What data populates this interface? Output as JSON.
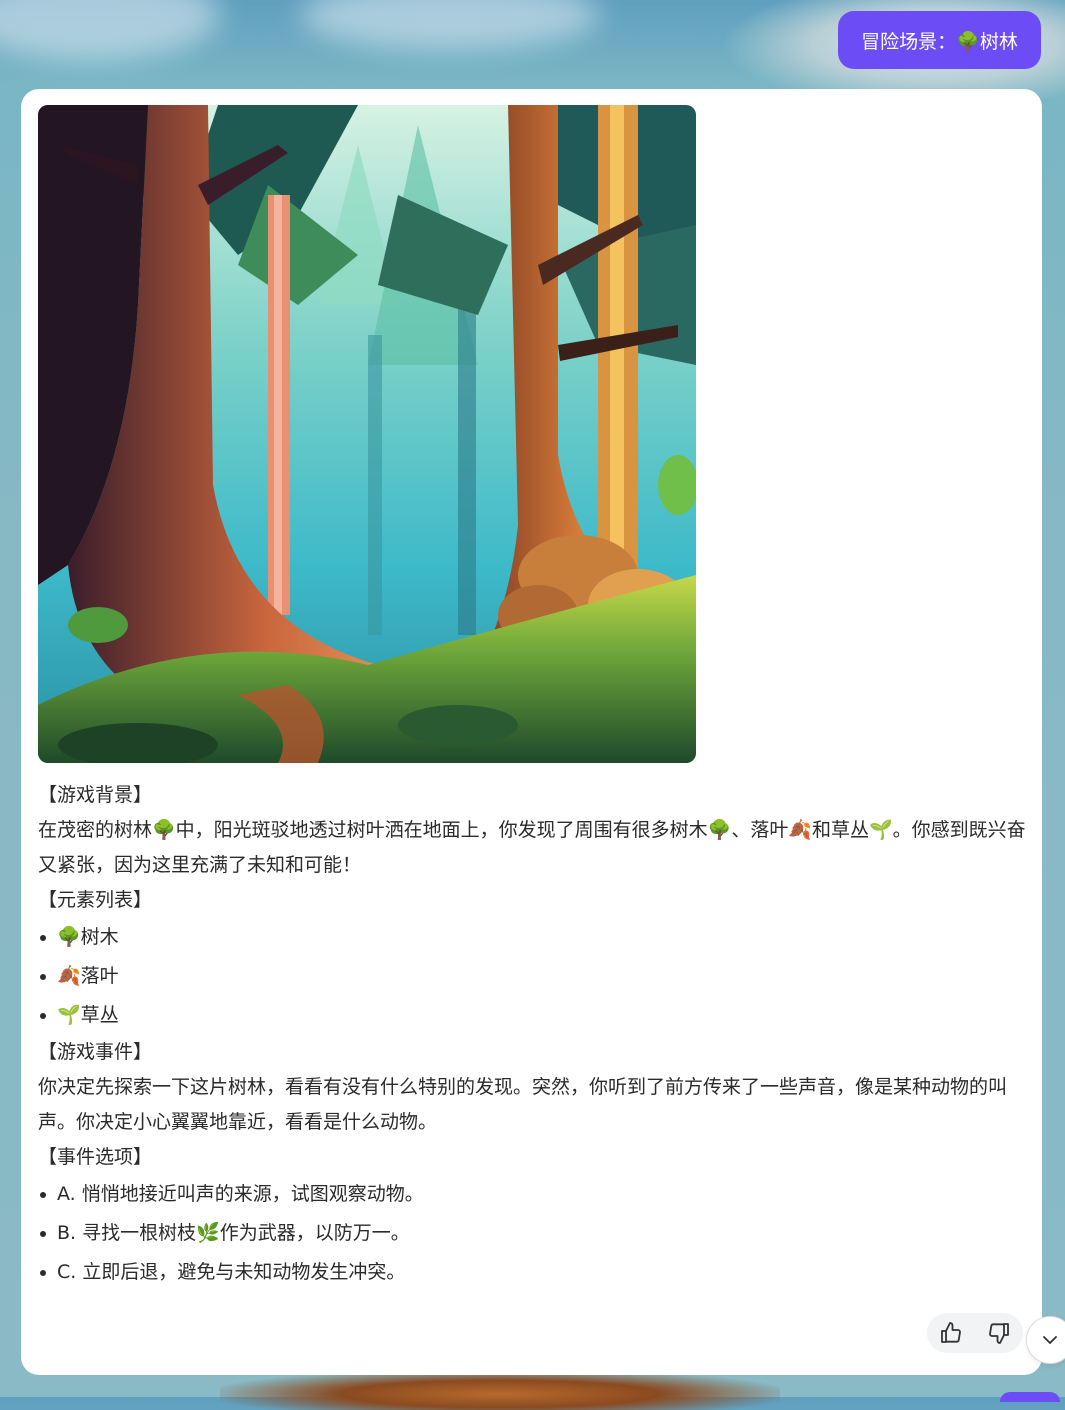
{
  "scene_pill": {
    "label": "冒险场景：🌳树林"
  },
  "content": {
    "bg_heading": "【游戏背景】",
    "bg_text": "在茂密的树林🌳中，阳光斑驳地透过树叶洒在地面上，你发现了周围有很多树木🌳、落叶🍂和草丛🌱。你感到既兴奋又紧张，因为这里充满了未知和可能！",
    "elements_heading": "【元素列表】",
    "elements": [
      "🌳树木",
      "🍂落叶",
      "🌱草丛"
    ],
    "event_heading": "【游戏事件】",
    "event_text": "你决定先探索一下这片树林，看看有没有什么特别的发现。突然，你听到了前方传来了一些声音，像是某种动物的叫声。你决定小心翼翼地靠近，看看是什么动物。",
    "options_heading": "【事件选项】",
    "options": [
      "A. 悄悄地接近叫声的来源，试图观察动物。",
      "B. 寻找一根树枝🌿作为武器，以防万一。",
      "C. 立即后退，避免与未知动物发生冲突。"
    ]
  },
  "icons": {
    "like": "thumbs-up-icon",
    "dislike": "thumbs-down-icon",
    "scroll": "chevron-down-icon"
  },
  "colors": {
    "accent": "#6c4cf5",
    "card_bg": "#ffffff",
    "page_bg": "#89bac6",
    "text": "#2b2b2b"
  }
}
